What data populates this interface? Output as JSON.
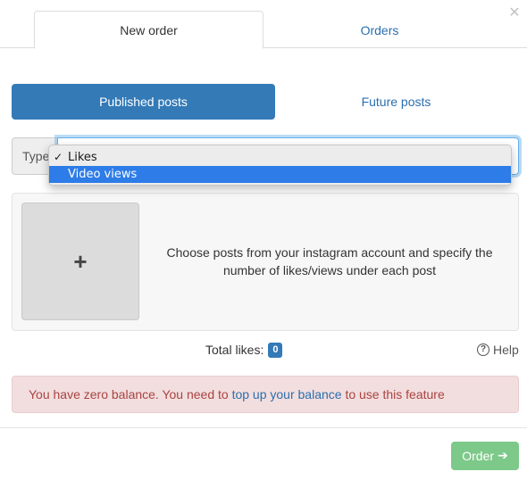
{
  "tabs": [
    {
      "label": "New order",
      "active": true
    },
    {
      "label": "Orders",
      "active": false
    }
  ],
  "close_icon": "close-icon",
  "post_source": {
    "published_label": "Published posts",
    "future_label": "Future posts",
    "active": "Published posts"
  },
  "type_select": {
    "addon_label": "Type",
    "options": [
      {
        "label": "Likes",
        "checked": true,
        "highlighted": false
      },
      {
        "label": "Video views",
        "checked": false,
        "highlighted": true
      }
    ]
  },
  "posts_panel": {
    "add_icon": "plus-icon",
    "hint": "Choose posts from your instagram account and specify the number of likes/views under each post"
  },
  "totals": {
    "label": "Total likes:",
    "value": "0"
  },
  "help": {
    "icon": "question-circle-icon",
    "label": "Help"
  },
  "alert": {
    "text_before": "You have zero balance. You need to ",
    "link_text": "top up your balance",
    "text_after": " to use this feature"
  },
  "order_button": {
    "label": "Order",
    "icon": "arrow-right-icon"
  },
  "colors": {
    "primary": "#337ab7",
    "link": "#2a6fb0",
    "alert_bg": "#f2dede",
    "alert_text": "#a94442",
    "order_button": "#7dc98a",
    "dropdown_highlight": "#2d7ce8"
  }
}
